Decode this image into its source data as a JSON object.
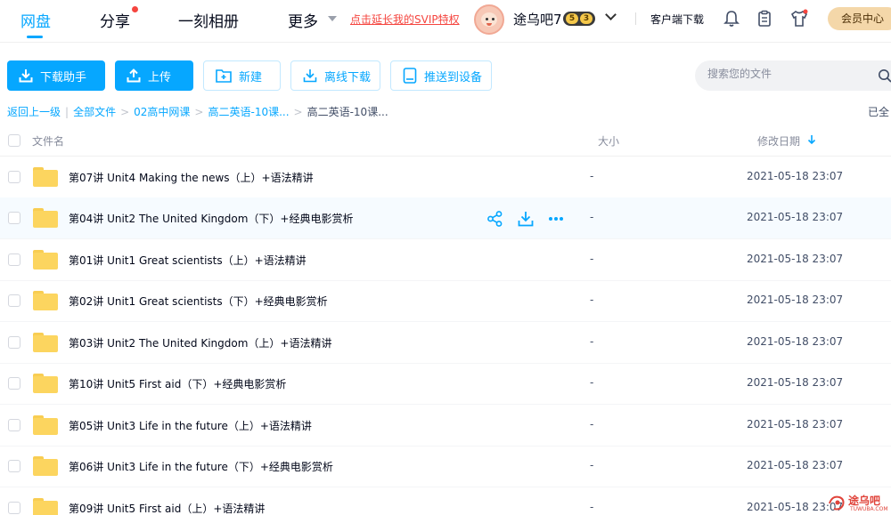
{
  "nav": {
    "tabs": [
      {
        "label": "网盘",
        "active": true
      },
      {
        "label": "分享"
      },
      {
        "label": "一刻相册"
      },
      {
        "label": "更多"
      }
    ],
    "svip_promo": "点击延长我的SVIP特权",
    "username": "途乌吧7",
    "level_a": "5",
    "level_b": "3",
    "client_download": "客户端下载",
    "vip_center": "会员中心"
  },
  "toolbar": {
    "download_helper": "下载助手",
    "upload": "上传",
    "new_folder": "新建",
    "offline_download": "离线下载",
    "push_device": "推送到设备",
    "search_placeholder": "搜索您的文件"
  },
  "breadcrumb": {
    "back": "返回上一级",
    "items": [
      "全部文件",
      "02高中网课",
      "高二英语-10课..."
    ],
    "current": "高二英语-10课...",
    "loaded_status": "已全"
  },
  "table": {
    "headers": {
      "name": "文件名",
      "size": "大小",
      "modified": "修改日期"
    },
    "rows": [
      {
        "name": "第07讲 Unit4 Making the news（上）+语法精讲",
        "size": "-",
        "date": "2021-05-18 23:07"
      },
      {
        "name": "第04讲 Unit2 The United Kingdom（下）+经典电影赏析",
        "size": "-",
        "date": "2021-05-18 23:07"
      },
      {
        "name": "第01讲 Unit1 Great scientists（上）+语法精讲",
        "size": "-",
        "date": "2021-05-18 23:07"
      },
      {
        "name": "第02讲 Unit1 Great scientists（下）+经典电影赏析",
        "size": "-",
        "date": "2021-05-18 23:07"
      },
      {
        "name": "第03讲 Unit2 The United Kingdom（上）+语法精讲",
        "size": "-",
        "date": "2021-05-18 23:07"
      },
      {
        "name": "第10讲 Unit5 First aid（下）+经典电影赏析",
        "size": "-",
        "date": "2021-05-18 23:07"
      },
      {
        "name": "第05讲 Unit3 Life in the future（上）+语法精讲",
        "size": "-",
        "date": "2021-05-18 23:07"
      },
      {
        "name": "第06讲 Unit3 Life in the future（下）+经典电影赏析",
        "size": "-",
        "date": "2021-05-18 23:07"
      },
      {
        "name": "第09讲 Unit5 First aid（上）+语法精讲",
        "size": "-",
        "date": "2021-05-18 23:07"
      }
    ]
  },
  "watermark": {
    "text": "途乌吧",
    "sub": "TUWUBA.COM"
  },
  "colors": {
    "accent": "#06a7ff",
    "promo": "#f5453f",
    "vip": "#f4d7a9",
    "folder": "#fcd55f"
  }
}
